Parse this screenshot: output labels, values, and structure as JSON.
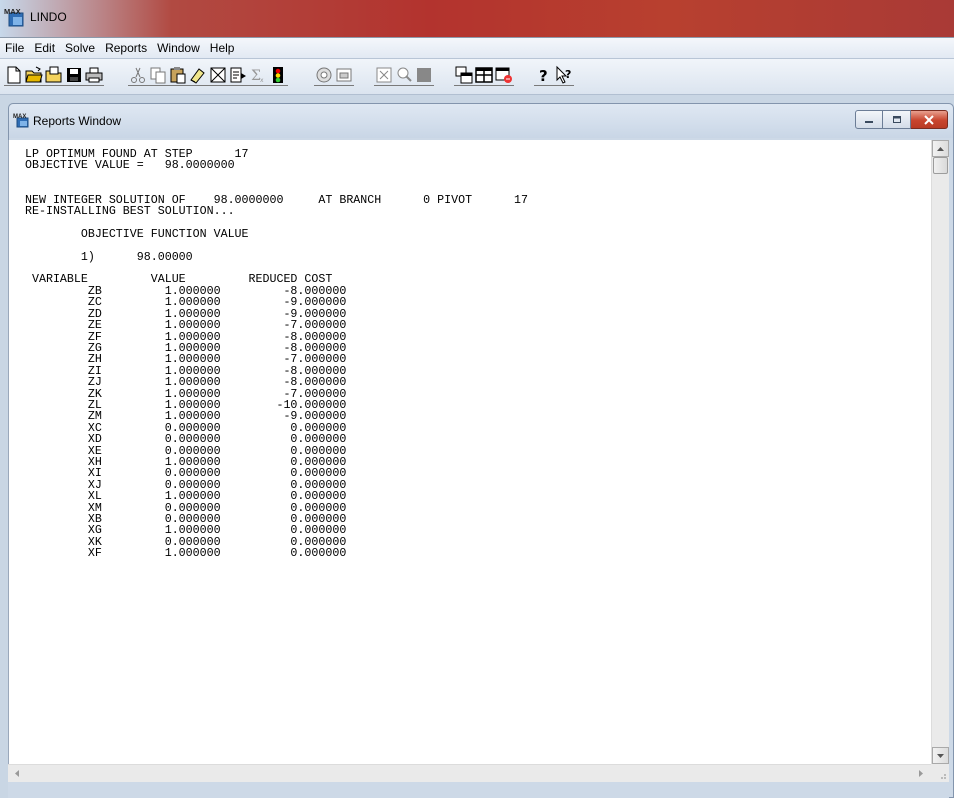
{
  "app": {
    "title": "LINDO",
    "icon": "lindo-max-icon",
    "icon_text": "MAX"
  },
  "menu": [
    "File",
    "Edit",
    "Solve",
    "Reports",
    "Window",
    "Help"
  ],
  "toolbar": {
    "buttons": [
      "new-file-icon",
      "open-file-icon",
      "view-icon",
      "save-icon",
      "print-icon",
      "cut-icon",
      "copy-icon",
      "paste-icon",
      "clear-icon",
      "find-icon",
      "next-icon",
      "summation-icon",
      "solve-icon",
      "compile-icon",
      "options-icon",
      "close-all-icon",
      "zoom-icon",
      "send-to-back-icon",
      "cascade-icon",
      "tile-icon",
      "title-icon",
      "help-icon",
      "context-help-icon"
    ]
  },
  "reports_window": {
    "title": "Reports Window",
    "icon": "lindo-max-icon",
    "icon_text": "MAX"
  },
  "report": {
    "header_lines": [
      "LP OPTIMUM FOUND AT STEP      17",
      "OBJECTIVE VALUE =   98.0000000",
      "",
      "",
      "NEW INTEGER SOLUTION OF    98.0000000     AT BRANCH      0 PIVOT      17",
      "RE-INSTALLING BEST SOLUTION...",
      "",
      "        OBJECTIVE FUNCTION VALUE",
      "",
      "        1)      98.00000",
      ""
    ],
    "columns": [
      "VARIABLE",
      "VALUE",
      "REDUCED COST"
    ],
    "rows": [
      [
        "ZB",
        "1.000000",
        "-8.000000"
      ],
      [
        "ZC",
        "1.000000",
        "-9.000000"
      ],
      [
        "ZD",
        "1.000000",
        "-9.000000"
      ],
      [
        "ZE",
        "1.000000",
        "-7.000000"
      ],
      [
        "ZF",
        "1.000000",
        "-8.000000"
      ],
      [
        "ZG",
        "1.000000",
        "-8.000000"
      ],
      [
        "ZH",
        "1.000000",
        "-7.000000"
      ],
      [
        "ZI",
        "1.000000",
        "-8.000000"
      ],
      [
        "ZJ",
        "1.000000",
        "-8.000000"
      ],
      [
        "ZK",
        "1.000000",
        "-7.000000"
      ],
      [
        "ZL",
        "1.000000",
        "-10.000000"
      ],
      [
        "ZM",
        "1.000000",
        "-9.000000"
      ],
      [
        "XC",
        "0.000000",
        "0.000000"
      ],
      [
        "XD",
        "0.000000",
        "0.000000"
      ],
      [
        "XE",
        "0.000000",
        "0.000000"
      ],
      [
        "XH",
        "1.000000",
        "0.000000"
      ],
      [
        "XI",
        "0.000000",
        "0.000000"
      ],
      [
        "XJ",
        "0.000000",
        "0.000000"
      ],
      [
        "XL",
        "1.000000",
        "0.000000"
      ],
      [
        "XM",
        "0.000000",
        "0.000000"
      ],
      [
        "XB",
        "0.000000",
        "0.000000"
      ],
      [
        "XG",
        "1.000000",
        "0.000000"
      ],
      [
        "XK",
        "0.000000",
        "0.000000"
      ],
      [
        "XF",
        "1.000000",
        "0.000000"
      ]
    ]
  },
  "colors": {
    "title_bar_red": "#b3332e",
    "close_button": "#c8452e",
    "mdi_background": "#c9d6e4"
  }
}
